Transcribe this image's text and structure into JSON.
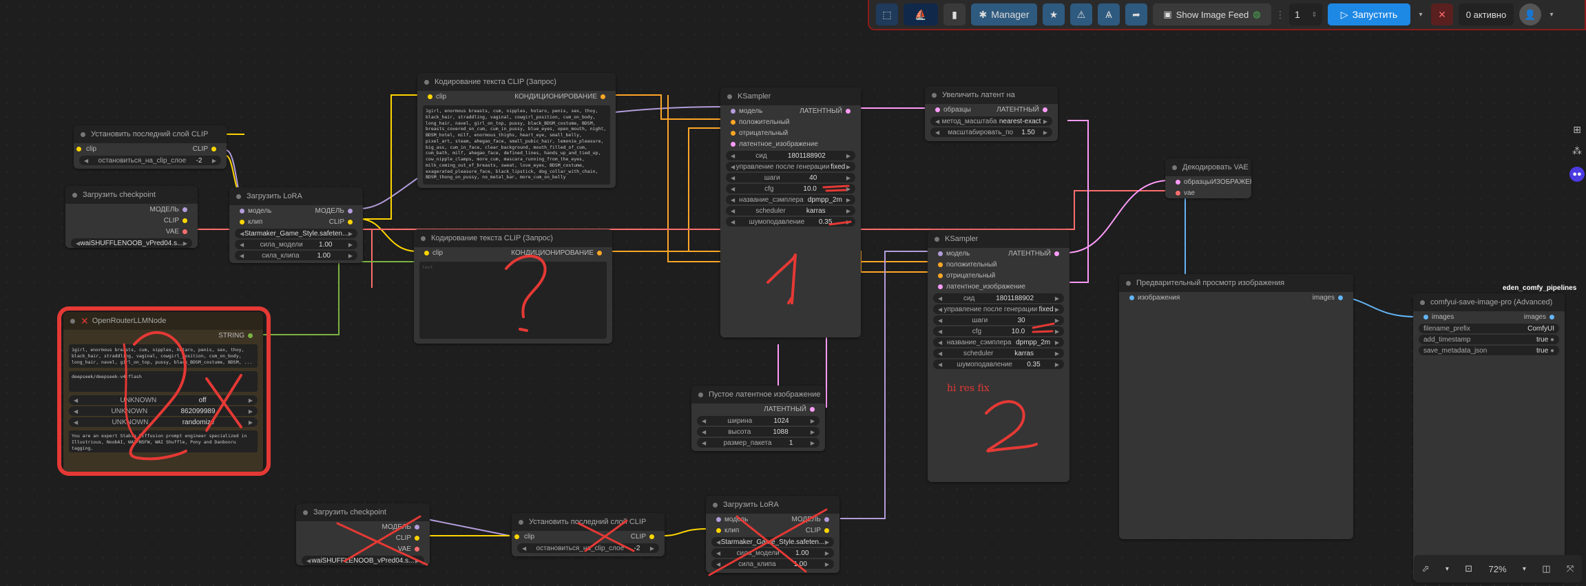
{
  "topbar": {
    "manager_label": "Manager",
    "show_feed_label": "Show Image Feed",
    "queue_count": "1",
    "run_label": "Запустить",
    "active_label": "0 активно"
  },
  "clip_set_last": {
    "title": "Установить последний слой CLIP",
    "in": "clip",
    "out": "CLIP",
    "w_label": "остановиться_на_clip_слое",
    "w_value": "-2"
  },
  "checkpoint": {
    "title": "Загрузить checkpoint",
    "o1": "МОДЕЛЬ",
    "o2": "CLIP",
    "o3": "VAE",
    "w_value": "waiSHUFFLENOOB_vPred04.s..."
  },
  "lora": {
    "title": "Загрузить LoRA",
    "i1": "модель",
    "i2": "клип",
    "o1": "МОДЕЛЬ",
    "o2": "CLIP",
    "w1_value": "Starmaker_Game_Style.safeten...",
    "w2_label": "сила_модели",
    "w2_value": "1.00",
    "w3_label": "сила_клипа",
    "w3_value": "1.00"
  },
  "clip_text_pos": {
    "title": "Кодирование текста CLIP (Запрос)",
    "in": "clip",
    "out": "КОНДИЦИОНИРОВАНИЕ",
    "text": "1girl, enormous breasts, cum, nipples, hotaro, penis, sex, thoy, black_hair, straddling, vaginal, cowgirl_position, cum_on_body, long_hair, navel, girl_on_top, pussy, black_BDSM_costume, BDSM, breasts_covered_on_cum, cum_in_pussy, blue_eyes, open_mouth, night, BDSM_hotel, milf, enormous_thighs, heart_eye, small_belly, pixel_art, steam, ahegao_face, small_pubic_hair, lemonie_pleasure, big_ass, cum_in_face, clear_background, mouth_filled_of_cum, cum_bath, milf, ahegao_face, defined_lines, hands_up_and_tied_up, cow_nipple_clamps, more_cum, mascara_running_from_the_eyes, milk_coming_out_of_breasts, sweat, love_eyes, BDSM_costume, exagerated_pleasure_face, black_lipstick, dog_collar_with_chain, BDSM_thong_on_pussy, no_metal_bar, more_cum_on_belly"
  },
  "clip_text_neg": {
    "title": "Кодирование текста CLIP (Запрос)",
    "in": "clip",
    "out": "КОНДИЦИОНИРОВАНИЕ",
    "text": "text"
  },
  "llm": {
    "title": "OpenRouterLLMNode",
    "out": "STRING",
    "text1": "1girl, enormous breasts, cum, nipples, hotaro, penis, sex, thoy, black_hair, straddling, vaginal, cowgirl_position, cum_on_body, long_hair, navel, girl_on_top, pussy, black_BDSM_costume, BDSM, ...",
    "text2": "deepseek/deepseek-v4-flash",
    "u1": "UNKNOWN",
    "v1": "off",
    "u2": "UNKNOWN",
    "v2": "862099989",
    "u3": "UNKNOWN",
    "v3": "randomize",
    "text3": "You are an expert Stable Diffusion prompt engineer specialized in Illustrious, NoobAI, WAI-NSFW, WAI Shuffle, Pony and Danbooru tagging."
  },
  "ks1": {
    "title": "KSampler",
    "i1": "модель",
    "i2": "положительный",
    "i3": "отрицательный",
    "i4": "латентное_изображение",
    "out": "ЛАТЕНТНЫЙ",
    "seed_l": "сид",
    "seed": "1801188902",
    "ctrl_l": "управление после генерации",
    "ctrl": "fixed",
    "steps_l": "шаги",
    "steps": "40",
    "cfg_l": "cfg",
    "cfg": "10.0",
    "sampler_l": "название_сэмплера",
    "sampler": "dpmpp_2m",
    "sched_l": "scheduler",
    "sched": "karras",
    "denoise_l": "шумоподавление",
    "denoise": "0.35"
  },
  "ks2": {
    "title": "KSampler",
    "i1": "модель",
    "i2": "положительный",
    "i3": "отрицательный",
    "i4": "латентное_изображение",
    "out": "ЛАТЕНТНЫЙ",
    "seed_l": "сид",
    "seed": "1801188902",
    "ctrl_l": "управление после генерации",
    "ctrl": "fixed",
    "steps_l": "шаги",
    "steps": "30",
    "cfg_l": "cfg",
    "cfg": "10.0",
    "sampler_l": "название_сэмплера",
    "sampler": "dpmpp_2m",
    "sched_l": "scheduler",
    "sched": "karras",
    "denoise_l": "шумоподавление",
    "denoise": "0.35"
  },
  "upscale": {
    "title": "Увеличить латент на",
    "in": "образцы",
    "out": "ЛАТЕНТНЫЙ",
    "w1_l": "метод_масштаба",
    "w1": "nearest-exact",
    "w2_l": "масштабировать_по",
    "w2": "1.50"
  },
  "vae_decode": {
    "title": "Декодировать VAE",
    "i1": "образцы",
    "i2": "vae",
    "out": "ИЗОБРАЖЕНИЕ"
  },
  "preview": {
    "title": "Предварительный просмотр изображения",
    "in": "изображения",
    "out": "images"
  },
  "save_pro": {
    "tag": "eden_comfy_pipelines",
    "title": "comfyui-save-image-pro (Advanced)",
    "in": "images",
    "out": "images",
    "w1_l": "filename_prefix",
    "w1": "ComfyUI",
    "w2_l": "add_timestamp",
    "w2": "true",
    "w3_l": "save_metadata_json",
    "w3": "true"
  },
  "empty_latent": {
    "title": "Пустое латентное изображение",
    "out": "ЛАТЕНТНЫЙ",
    "w1_l": "ширина",
    "w1": "1024",
    "w2_l": "высота",
    "w2": "1088",
    "w3_l": "размер_пакета",
    "w3": "1"
  },
  "checkpoint2": {
    "title": "Загрузить checkpoint",
    "o1": "МОДЕЛЬ",
    "o2": "CLIP",
    "o3": "VAE",
    "w_value": "waiSHUFFLENOOB_vPred04.s..."
  },
  "clip_set_last2": {
    "title": "Установить последний слой CLIP",
    "in": "clip",
    "out": "CLIP",
    "w_label": "остановиться_на_clip_слое",
    "w_value": "-2"
  },
  "lora2": {
    "title": "Загрузить LoRA",
    "i1": "модель",
    "i2": "клип",
    "o1": "МОДЕЛЬ",
    "o2": "CLIP",
    "w1_value": "Starmaker_Game_Style.safeten...",
    "w2_label": "сила_модели",
    "w2_value": "1.00",
    "w3_label": "сила_клипа",
    "w3_value": "1.00"
  },
  "annotations": {
    "hires": "hi res fix"
  },
  "zoom": {
    "value": "72%"
  },
  "colors": {
    "model": "#b39ddb",
    "clip": "#ffd600",
    "vae": "#ff6e6e",
    "cond": "#ffa726",
    "latent": "#ff9cf9",
    "image": "#64b5f6",
    "string": "#7cb342",
    "annot": "#e53935"
  }
}
